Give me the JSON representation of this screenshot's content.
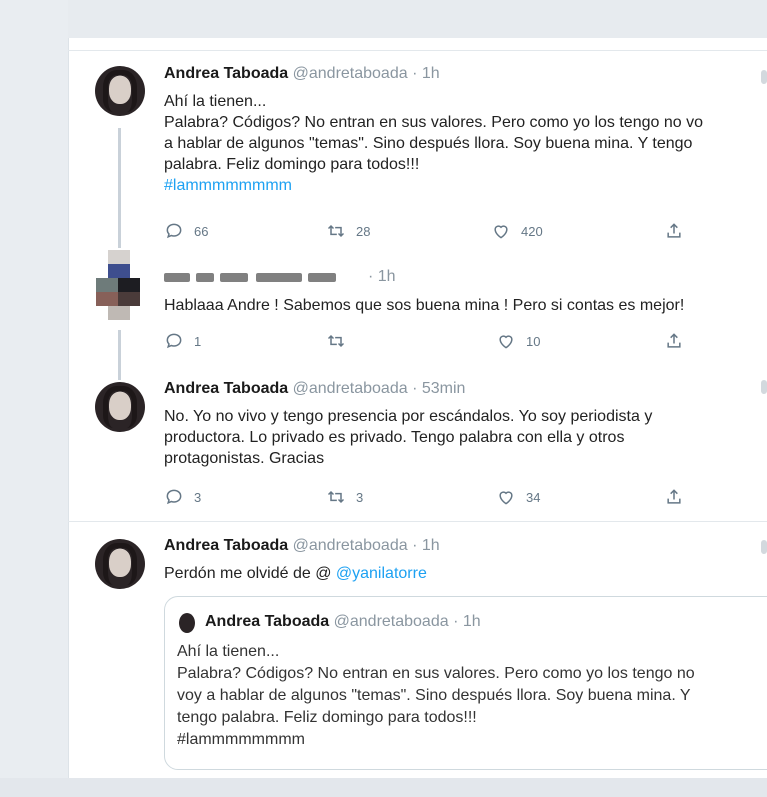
{
  "tweets": [
    {
      "name": "Andrea Taboada",
      "handle": "@andretaboada · 1h",
      "lines": [
        "Ahí la tienen...",
        "Palabra? Códigos? No entran en sus valores. Pero como yo los tengo no vo",
        "a hablar de algunos \"temas\". Sino después llora. Soy buena mina. Y tengo",
        "palabra. Feliz domingo para todos!!!"
      ],
      "hashtag": "#lammmmmmmm",
      "replies": "66",
      "retweets": "28",
      "likes": "420"
    },
    {
      "name": "",
      "handle": "· 1h",
      "lines": [
        "Hablaaa Andre ! Sabemos que sos buena mina ! Pero si contas es mejor!"
      ],
      "replies": "1",
      "retweets": "",
      "likes": "10"
    },
    {
      "name": "Andrea Taboada",
      "handle": "@andretaboada · 53min",
      "lines": [
        "No. Yo no vivo y tengo presencia por escándalos. Yo soy periodista y",
        "productora. Lo privado es privado. Tengo palabra con ella y otros",
        "protagonistas. Gracias"
      ],
      "replies": "3",
      "retweets": "3",
      "likes": "34"
    },
    {
      "name": "Andrea Taboada",
      "handle": "@andretaboada · 1h",
      "text_prefix": "Perdón me olvidé de @ ",
      "mention": "@yanilatorre"
    }
  ],
  "quote": {
    "name": "Andrea Taboada",
    "handle": "@andretaboada · 1h",
    "lines": [
      "Ahí la tienen...",
      "Palabra? Códigos? No entran en sus valores. Pero como yo los tengo no",
      "voy a hablar de algunos \"temas\". Sino después llora. Soy buena mina. Y",
      "tengo palabra. Feliz domingo para todos!!!",
      "#lammmmmmmm"
    ]
  },
  "icons": [
    "reply-icon",
    "retweet-icon",
    "like-icon",
    "share-icon"
  ],
  "colors": {
    "link": "#1da1f2",
    "meta": "#8a96a0",
    "icon": "#657786"
  }
}
